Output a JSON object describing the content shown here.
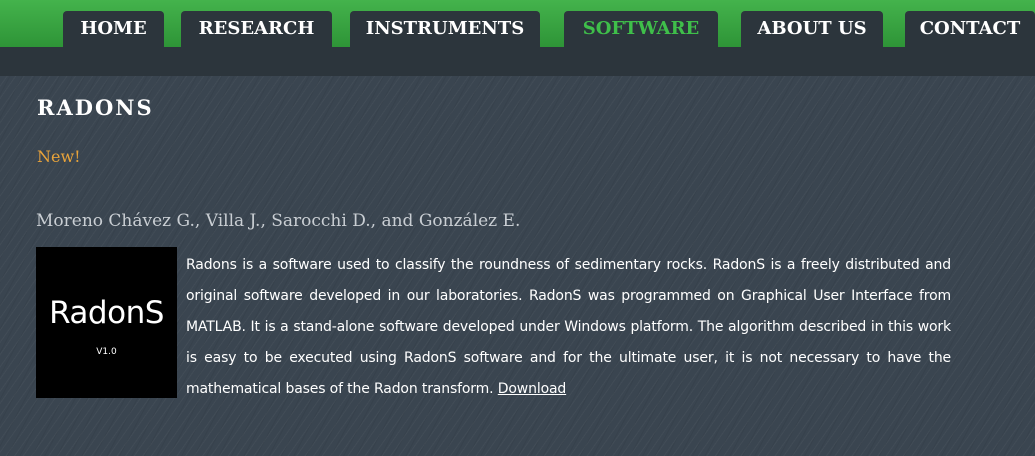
{
  "nav": {
    "items": [
      {
        "label": "HOME"
      },
      {
        "label": "RESEARCH"
      },
      {
        "label": "INSTRUMENTS"
      },
      {
        "label": "SOFTWARE",
        "active": true
      },
      {
        "label": "ABOUT US"
      },
      {
        "label": "CONTACT"
      }
    ]
  },
  "page": {
    "title": "RADONS",
    "new_tag": "New!",
    "authors": "Moreno Chávez G., Villa J., Sarocchi D., and González E.",
    "logo": {
      "title": "RadonS",
      "version": "V1.0"
    },
    "description": "Radons is a software used to classify the roundness of sedimentary rocks. RadonS is a freely distributed and original software developed in our laboratories. RadonS was programmed on Graphical User Interface from MATLAB. It is a stand-alone software developed under Windows platform. The algorithm described in this work is easy to be executed using RadonS software and for the ultimate user, it is not necessary to have the mathematical bases of the Radon transform.",
    "download_label": "Download"
  },
  "colors": {
    "nav_green": "#3aa843",
    "nav_dark": "#2c353c",
    "active_tab_text": "#3fbf4a",
    "new_tag": "#e8a33a",
    "background": "#3a4550"
  }
}
